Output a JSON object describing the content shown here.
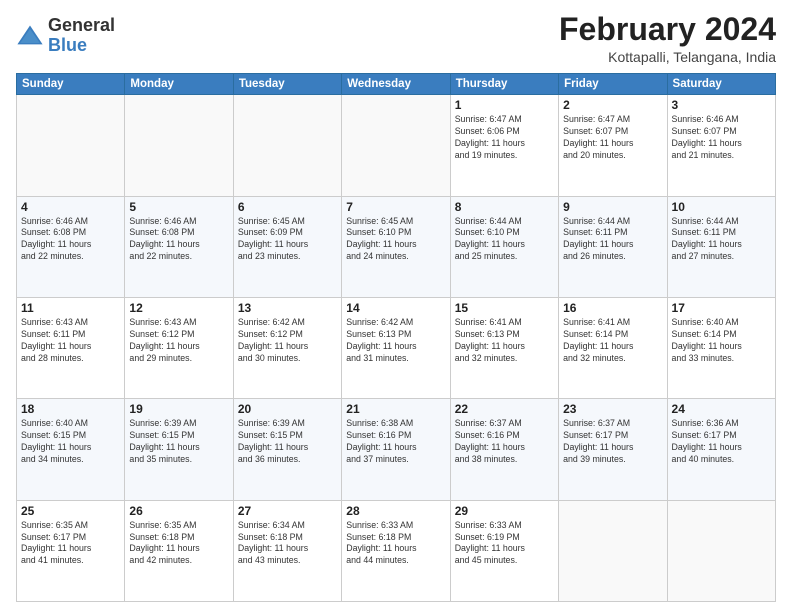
{
  "header": {
    "logo_general": "General",
    "logo_blue": "Blue",
    "month_title": "February 2024",
    "location": "Kottapalli, Telangana, India"
  },
  "days_of_week": [
    "Sunday",
    "Monday",
    "Tuesday",
    "Wednesday",
    "Thursday",
    "Friday",
    "Saturday"
  ],
  "weeks": [
    [
      {
        "day": "",
        "info": ""
      },
      {
        "day": "",
        "info": ""
      },
      {
        "day": "",
        "info": ""
      },
      {
        "day": "",
        "info": ""
      },
      {
        "day": "1",
        "info": "Sunrise: 6:47 AM\nSunset: 6:06 PM\nDaylight: 11 hours\nand 19 minutes."
      },
      {
        "day": "2",
        "info": "Sunrise: 6:47 AM\nSunset: 6:07 PM\nDaylight: 11 hours\nand 20 minutes."
      },
      {
        "day": "3",
        "info": "Sunrise: 6:46 AM\nSunset: 6:07 PM\nDaylight: 11 hours\nand 21 minutes."
      }
    ],
    [
      {
        "day": "4",
        "info": "Sunrise: 6:46 AM\nSunset: 6:08 PM\nDaylight: 11 hours\nand 22 minutes."
      },
      {
        "day": "5",
        "info": "Sunrise: 6:46 AM\nSunset: 6:08 PM\nDaylight: 11 hours\nand 22 minutes."
      },
      {
        "day": "6",
        "info": "Sunrise: 6:45 AM\nSunset: 6:09 PM\nDaylight: 11 hours\nand 23 minutes."
      },
      {
        "day": "7",
        "info": "Sunrise: 6:45 AM\nSunset: 6:10 PM\nDaylight: 11 hours\nand 24 minutes."
      },
      {
        "day": "8",
        "info": "Sunrise: 6:44 AM\nSunset: 6:10 PM\nDaylight: 11 hours\nand 25 minutes."
      },
      {
        "day": "9",
        "info": "Sunrise: 6:44 AM\nSunset: 6:11 PM\nDaylight: 11 hours\nand 26 minutes."
      },
      {
        "day": "10",
        "info": "Sunrise: 6:44 AM\nSunset: 6:11 PM\nDaylight: 11 hours\nand 27 minutes."
      }
    ],
    [
      {
        "day": "11",
        "info": "Sunrise: 6:43 AM\nSunset: 6:11 PM\nDaylight: 11 hours\nand 28 minutes."
      },
      {
        "day": "12",
        "info": "Sunrise: 6:43 AM\nSunset: 6:12 PM\nDaylight: 11 hours\nand 29 minutes."
      },
      {
        "day": "13",
        "info": "Sunrise: 6:42 AM\nSunset: 6:12 PM\nDaylight: 11 hours\nand 30 minutes."
      },
      {
        "day": "14",
        "info": "Sunrise: 6:42 AM\nSunset: 6:13 PM\nDaylight: 11 hours\nand 31 minutes."
      },
      {
        "day": "15",
        "info": "Sunrise: 6:41 AM\nSunset: 6:13 PM\nDaylight: 11 hours\nand 32 minutes."
      },
      {
        "day": "16",
        "info": "Sunrise: 6:41 AM\nSunset: 6:14 PM\nDaylight: 11 hours\nand 32 minutes."
      },
      {
        "day": "17",
        "info": "Sunrise: 6:40 AM\nSunset: 6:14 PM\nDaylight: 11 hours\nand 33 minutes."
      }
    ],
    [
      {
        "day": "18",
        "info": "Sunrise: 6:40 AM\nSunset: 6:15 PM\nDaylight: 11 hours\nand 34 minutes."
      },
      {
        "day": "19",
        "info": "Sunrise: 6:39 AM\nSunset: 6:15 PM\nDaylight: 11 hours\nand 35 minutes."
      },
      {
        "day": "20",
        "info": "Sunrise: 6:39 AM\nSunset: 6:15 PM\nDaylight: 11 hours\nand 36 minutes."
      },
      {
        "day": "21",
        "info": "Sunrise: 6:38 AM\nSunset: 6:16 PM\nDaylight: 11 hours\nand 37 minutes."
      },
      {
        "day": "22",
        "info": "Sunrise: 6:37 AM\nSunset: 6:16 PM\nDaylight: 11 hours\nand 38 minutes."
      },
      {
        "day": "23",
        "info": "Sunrise: 6:37 AM\nSunset: 6:17 PM\nDaylight: 11 hours\nand 39 minutes."
      },
      {
        "day": "24",
        "info": "Sunrise: 6:36 AM\nSunset: 6:17 PM\nDaylight: 11 hours\nand 40 minutes."
      }
    ],
    [
      {
        "day": "25",
        "info": "Sunrise: 6:35 AM\nSunset: 6:17 PM\nDaylight: 11 hours\nand 41 minutes."
      },
      {
        "day": "26",
        "info": "Sunrise: 6:35 AM\nSunset: 6:18 PM\nDaylight: 11 hours\nand 42 minutes."
      },
      {
        "day": "27",
        "info": "Sunrise: 6:34 AM\nSunset: 6:18 PM\nDaylight: 11 hours\nand 43 minutes."
      },
      {
        "day": "28",
        "info": "Sunrise: 6:33 AM\nSunset: 6:18 PM\nDaylight: 11 hours\nand 44 minutes."
      },
      {
        "day": "29",
        "info": "Sunrise: 6:33 AM\nSunset: 6:19 PM\nDaylight: 11 hours\nand 45 minutes."
      },
      {
        "day": "",
        "info": ""
      },
      {
        "day": "",
        "info": ""
      }
    ]
  ]
}
